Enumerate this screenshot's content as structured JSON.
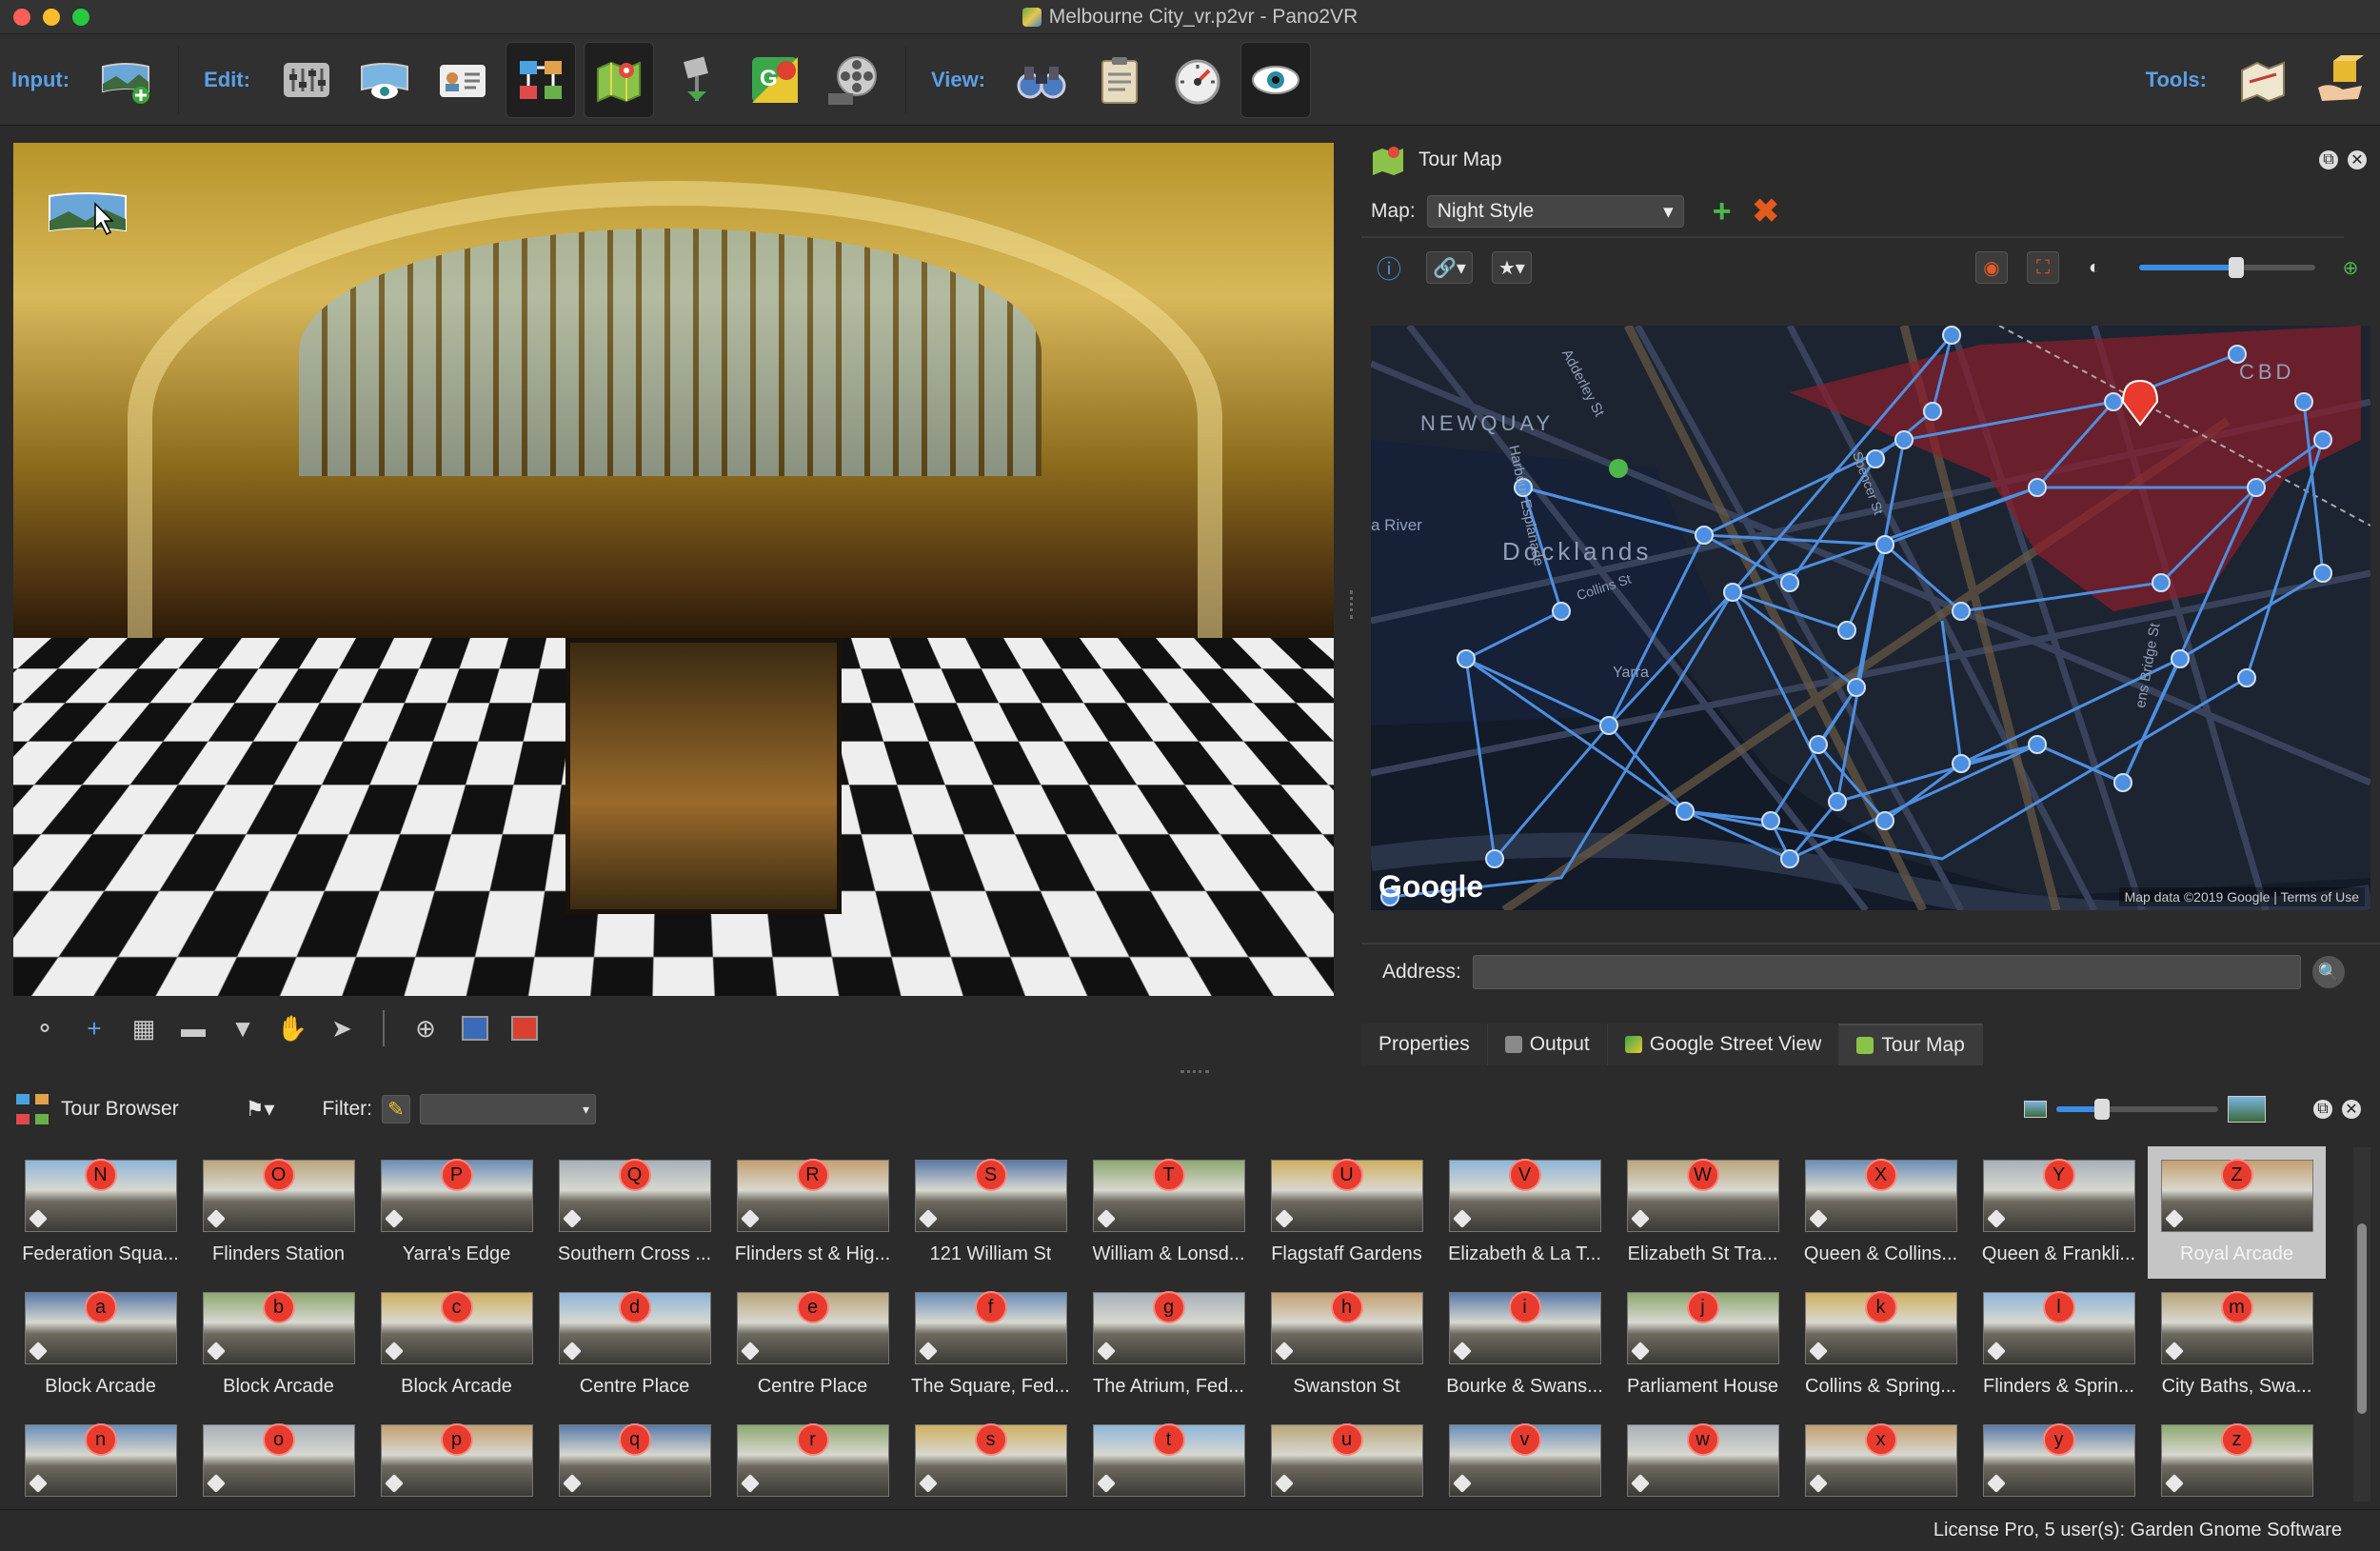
{
  "window": {
    "title": "Melbourne City_vr.p2vr - Pano2VR"
  },
  "toolbar": {
    "input_label": "Input:",
    "edit_label": "Edit:",
    "view_label": "View:",
    "tools_label": "Tools:"
  },
  "tourmap": {
    "title": "Tour Map",
    "map_label": "Map:",
    "map_value": "Night Style",
    "zoom": 0.55,
    "labels": {
      "newquay": "NEWQUAY",
      "docklands": "Docklands",
      "cbd": "CBD",
      "river": "a River",
      "yarra": "Yarra",
      "adderley": "Adderley St",
      "harbour": "Harbour Esplanade",
      "collins": "Collins St",
      "spencer": "Spencer St",
      "queensbridge": "ens Bridge St"
    },
    "google": "Google",
    "copyright": "Map data ©2019 Google",
    "terms": "Terms of Use",
    "address_label": "Address:"
  },
  "tabs": [
    {
      "label": "Properties"
    },
    {
      "label": "Output"
    },
    {
      "label": "Google Street View"
    },
    {
      "label": "Tour Map"
    }
  ],
  "browser": {
    "title": "Tour Browser",
    "filter_label": "Filter:",
    "thumb_size": 0.28,
    "rows": [
      [
        {
          "badge": "N",
          "label": "Federation Squa..."
        },
        {
          "badge": "O",
          "label": "Flinders Station"
        },
        {
          "badge": "P",
          "label": "Yarra's Edge"
        },
        {
          "badge": "Q",
          "label": "Southern Cross ..."
        },
        {
          "badge": "R",
          "label": "Flinders st & Hig..."
        },
        {
          "badge": "S",
          "label": "121 William St"
        },
        {
          "badge": "T",
          "label": "William & Lonsd..."
        },
        {
          "badge": "U",
          "label": "Flagstaff Gardens"
        },
        {
          "badge": "V",
          "label": "Elizabeth & La T..."
        },
        {
          "badge": "W",
          "label": "Elizabeth St Tra..."
        },
        {
          "badge": "X",
          "label": "Queen & Collins..."
        },
        {
          "badge": "Y",
          "label": "Queen & Frankli..."
        },
        {
          "badge": "Z",
          "label": "Royal Arcade"
        }
      ],
      [
        {
          "badge": "a",
          "label": "Block Arcade"
        },
        {
          "badge": "b",
          "label": "Block Arcade"
        },
        {
          "badge": "c",
          "label": "Block Arcade"
        },
        {
          "badge": "d",
          "label": "Centre Place"
        },
        {
          "badge": "e",
          "label": "Centre Place"
        },
        {
          "badge": "f",
          "label": "The Square, Fed..."
        },
        {
          "badge": "g",
          "label": "The Atrium, Fed..."
        },
        {
          "badge": "h",
          "label": "Swanston St"
        },
        {
          "badge": "i",
          "label": "Bourke & Swans..."
        },
        {
          "badge": "j",
          "label": "Parliament House"
        },
        {
          "badge": "k",
          "label": "Collins & Spring..."
        },
        {
          "badge": "l",
          "label": "Flinders & Sprin..."
        },
        {
          "badge": "m",
          "label": "City Baths, Swa..."
        }
      ],
      [
        {
          "badge": "n",
          "label": ""
        },
        {
          "badge": "o",
          "label": ""
        },
        {
          "badge": "p",
          "label": ""
        },
        {
          "badge": "q",
          "label": ""
        },
        {
          "badge": "r",
          "label": ""
        },
        {
          "badge": "s",
          "label": ""
        },
        {
          "badge": "t",
          "label": ""
        },
        {
          "badge": "u",
          "label": ""
        },
        {
          "badge": "v",
          "label": ""
        },
        {
          "badge": "w",
          "label": ""
        },
        {
          "badge": "x",
          "label": ""
        },
        {
          "badge": "y",
          "label": ""
        },
        {
          "badge": "z",
          "label": ""
        }
      ]
    ]
  },
  "status": {
    "license": "License Pro, 5 user(s): Garden Gnome Software"
  },
  "colors": {
    "accent": "#5aa0e6",
    "badge": "#e83b2e",
    "map_route": "#4d8fe0",
    "map_cbd": "#8b1e2b"
  }
}
